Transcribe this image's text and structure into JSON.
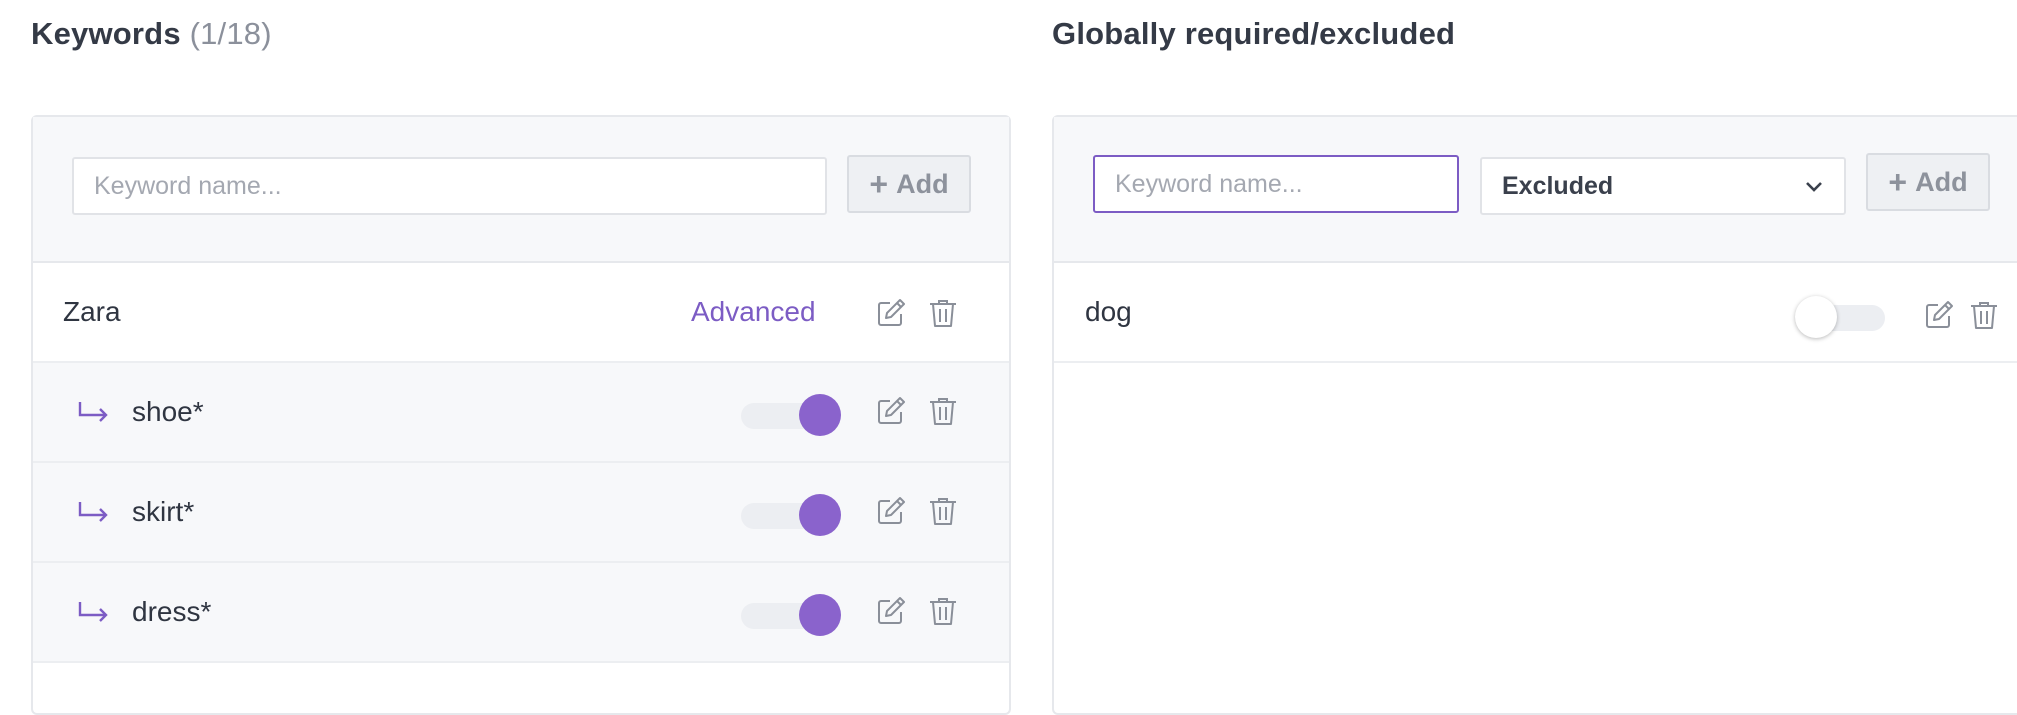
{
  "keywords": {
    "title": "Keywords",
    "count": "(1/18)",
    "input_placeholder": "Keyword name...",
    "add_label": "Add",
    "groups": [
      {
        "name": "Zara",
        "advanced_label": "Advanced",
        "children": [
          {
            "name": "shoe*",
            "enabled": true
          },
          {
            "name": "skirt*",
            "enabled": true
          },
          {
            "name": "dress*",
            "enabled": true
          }
        ]
      }
    ]
  },
  "global": {
    "title": "Globally required/excluded",
    "input_placeholder": "Keyword name...",
    "select_value": "Excluded",
    "add_label": "Add",
    "items": [
      {
        "name": "dog",
        "enabled": false
      }
    ]
  },
  "colors": {
    "accent": "#7c5cc4",
    "toggle_on": "#8a63cc",
    "panel_bg": "#f7f8fa",
    "border": "#e6e8ec"
  },
  "icons": {
    "sub_row": "return-arrow-icon",
    "edit": "edit-icon",
    "delete": "trash-icon",
    "dropdown": "chevron-down-icon",
    "add": "plus-icon"
  }
}
